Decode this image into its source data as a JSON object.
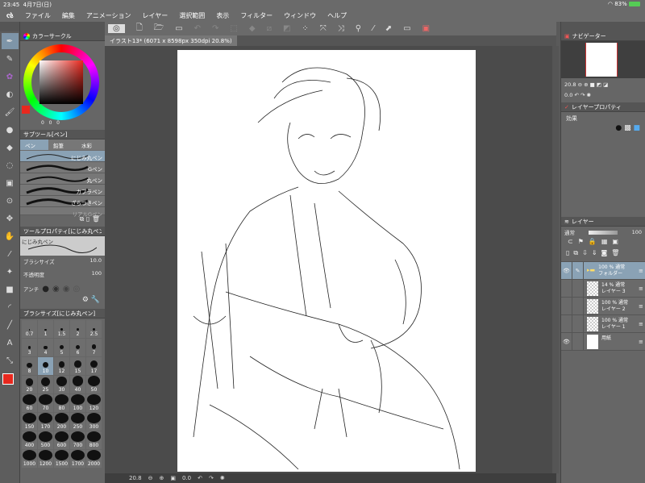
{
  "status": {
    "time": "23:45",
    "date": "4月7日(日)",
    "battery": "83%"
  },
  "menu": [
    "ファイル",
    "編集",
    "アニメーション",
    "レイヤー",
    "選択範囲",
    "表示",
    "フィルター",
    "ウィンドウ",
    "ヘルプ"
  ],
  "document_tab": "イラスト13* (6071 x 8598px 350dpi 20.8%)",
  "color_panel": {
    "title": "カラーサークル",
    "main_color": "#e8281e",
    "h_values": [
      "0",
      "0",
      "0"
    ]
  },
  "subtool": {
    "title": "サブツール[ペン]",
    "tabs": [
      "ペン",
      "鉛筆",
      "水彩"
    ],
    "items": [
      "にじみ丸ペン",
      "Gペン",
      "丸ペン",
      "カブラペン",
      "ざらつきペン",
      "リアルGペン"
    ],
    "selected": 0
  },
  "tool_property": {
    "title": "ツールプロパティ[にじみ丸ペン]",
    "preview_label": "にじみ丸ペン",
    "brush_size_label": "ブラシサイズ",
    "brush_size": "10.0",
    "opacity_label": "不透明度",
    "opacity": "100",
    "aa_label": "アンチ"
  },
  "brush_size_panel": {
    "title": "ブラシサイズ[にじみ丸ペン]",
    "sizes": [
      "0.7",
      "1",
      "1.5",
      "2",
      "2.5",
      "3",
      "4",
      "5",
      "6",
      "7",
      "8",
      "10",
      "12",
      "15",
      "17",
      "20",
      "25",
      "30",
      "40",
      "50",
      "60",
      "70",
      "80",
      "100",
      "120",
      "150",
      "170",
      "200",
      "250",
      "300",
      "400",
      "500",
      "600",
      "700",
      "800",
      "1000",
      "1200",
      "1500",
      "1700",
      "2000"
    ],
    "selected": "10"
  },
  "navigator": {
    "title": "ナビゲーター",
    "zoom": "20.8",
    "rotation": "0.0"
  },
  "layer_property": {
    "title": "レイヤープロパティ",
    "effect_label": "効果"
  },
  "layers_panel": {
    "title": "レイヤー",
    "blend": "通常",
    "opacity": "100",
    "layers": [
      {
        "info": "100 % 通常",
        "name": "フォルダー",
        "type": "folder",
        "visible": true,
        "selected": true
      },
      {
        "info": "14 % 通常",
        "name": "レイヤー 3",
        "type": "raster",
        "visible": false
      },
      {
        "info": "100 % 通常",
        "name": "レイヤー 2",
        "type": "raster",
        "visible": false
      },
      {
        "info": "100 % 通常",
        "name": "レイヤー 1",
        "type": "raster",
        "visible": false
      },
      {
        "info": "",
        "name": "用紙",
        "type": "paper",
        "visible": true
      }
    ]
  },
  "bottom": {
    "zoom": "20.8",
    "rotation": "0.0"
  }
}
